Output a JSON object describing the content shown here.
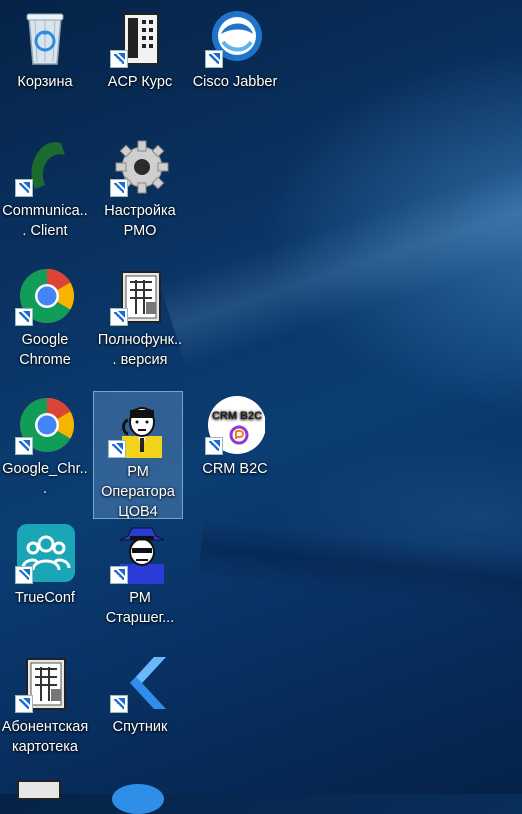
{
  "desktop": {
    "icons": [
      {
        "label": "Корзина",
        "icon": "recycle-bin-icon"
      },
      {
        "label": "ACP Курс",
        "icon": "phone-terminal-icon"
      },
      {
        "label": "Cisco Jabber",
        "icon": "cisco-jabber-icon"
      },
      {
        "label": "Communica... Client",
        "icon": "phone-handset-icon"
      },
      {
        "label": "Настройка РМО",
        "icon": "gear-icon"
      },
      {
        "label": "Google Chrome",
        "icon": "chrome-icon"
      },
      {
        "label": "Полнофунк... версия",
        "icon": "terminal-app-icon"
      },
      {
        "label": "Google_Chr...",
        "icon": "chrome-icon"
      },
      {
        "label": "РМ Оператора ЦОВ4",
        "icon": "operator-person-icon"
      },
      {
        "label": "CRM B2C",
        "icon": "crm-b2c-icon"
      },
      {
        "label": "TrueConf",
        "icon": "trueconf-icon"
      },
      {
        "label": "РМ Старшег...",
        "icon": "agent-hat-icon"
      },
      {
        "label": "Абонентская картотека",
        "icon": "terminal-app-icon"
      },
      {
        "label": "Спутник",
        "icon": "sputnik-icon"
      }
    ],
    "selected_icon": "РМ Оператора ЦОВ4",
    "crm_badge_text": "CRM B2C"
  }
}
